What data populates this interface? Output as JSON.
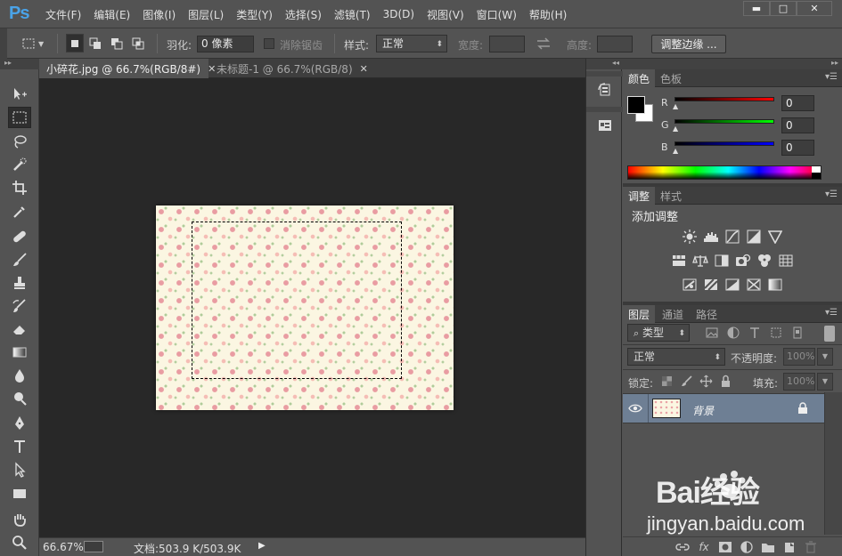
{
  "app": {
    "logo": "Ps",
    "menu": [
      "文件(F)",
      "编辑(E)",
      "图像(I)",
      "图层(L)",
      "类型(Y)",
      "选择(S)",
      "滤镜(T)",
      "3D(D)",
      "视图(V)",
      "窗口(W)",
      "帮助(H)"
    ],
    "window_buttons": {
      "minimize": "▬",
      "maximize": "□",
      "close": "✕"
    }
  },
  "options": {
    "feather_label": "羽化:",
    "feather_value": "0 像素",
    "antialias_label": "消除锯齿",
    "style_label": "样式:",
    "style_value": "正常",
    "width_label": "宽度:",
    "height_label": "高度:",
    "refine_edge_label": "调整边缘 ..."
  },
  "documents": {
    "tabs": [
      {
        "title": "小碎花.jpg @ 66.7%(RGB/8#)",
        "close": "✕",
        "active": true
      },
      {
        "title": "未标题-1 @ 66.7%(RGB/8)",
        "close": "✕",
        "active": false
      }
    ]
  },
  "status": {
    "zoom": "66.67%",
    "doc_size": "文档:503.9 K/503.9K",
    "arrow": "▶"
  },
  "color_panel": {
    "tabs": [
      "颜色",
      "色板"
    ],
    "channels": [
      {
        "label": "R",
        "value": "0",
        "color": "#ff0000"
      },
      {
        "label": "G",
        "value": "0",
        "color": "#00ff00"
      },
      {
        "label": "B",
        "value": "0",
        "color": "#0000ff"
      }
    ]
  },
  "adjustments_panel": {
    "tabs": [
      "调整",
      "样式"
    ],
    "title": "添加调整"
  },
  "layers_panel": {
    "tabs": [
      "图层",
      "通道",
      "路径"
    ],
    "kind_label": "类型",
    "blend_mode": "正常",
    "opacity_label": "不透明度:",
    "opacity_value": "100%",
    "lock_label": "锁定:",
    "fill_label": "填充:",
    "fill_value": "100%",
    "layers": [
      {
        "name": "背景",
        "visible": true,
        "locked": true
      }
    ]
  },
  "watermark": {
    "main": "Bai经验",
    "sub": "jingyan.baidu.com"
  },
  "colors": {
    "ui_bg": "#535353",
    "canvas_bg": "#282828",
    "accent_logo": "#4aa3e8",
    "layer_selected": "#6e7f94"
  }
}
